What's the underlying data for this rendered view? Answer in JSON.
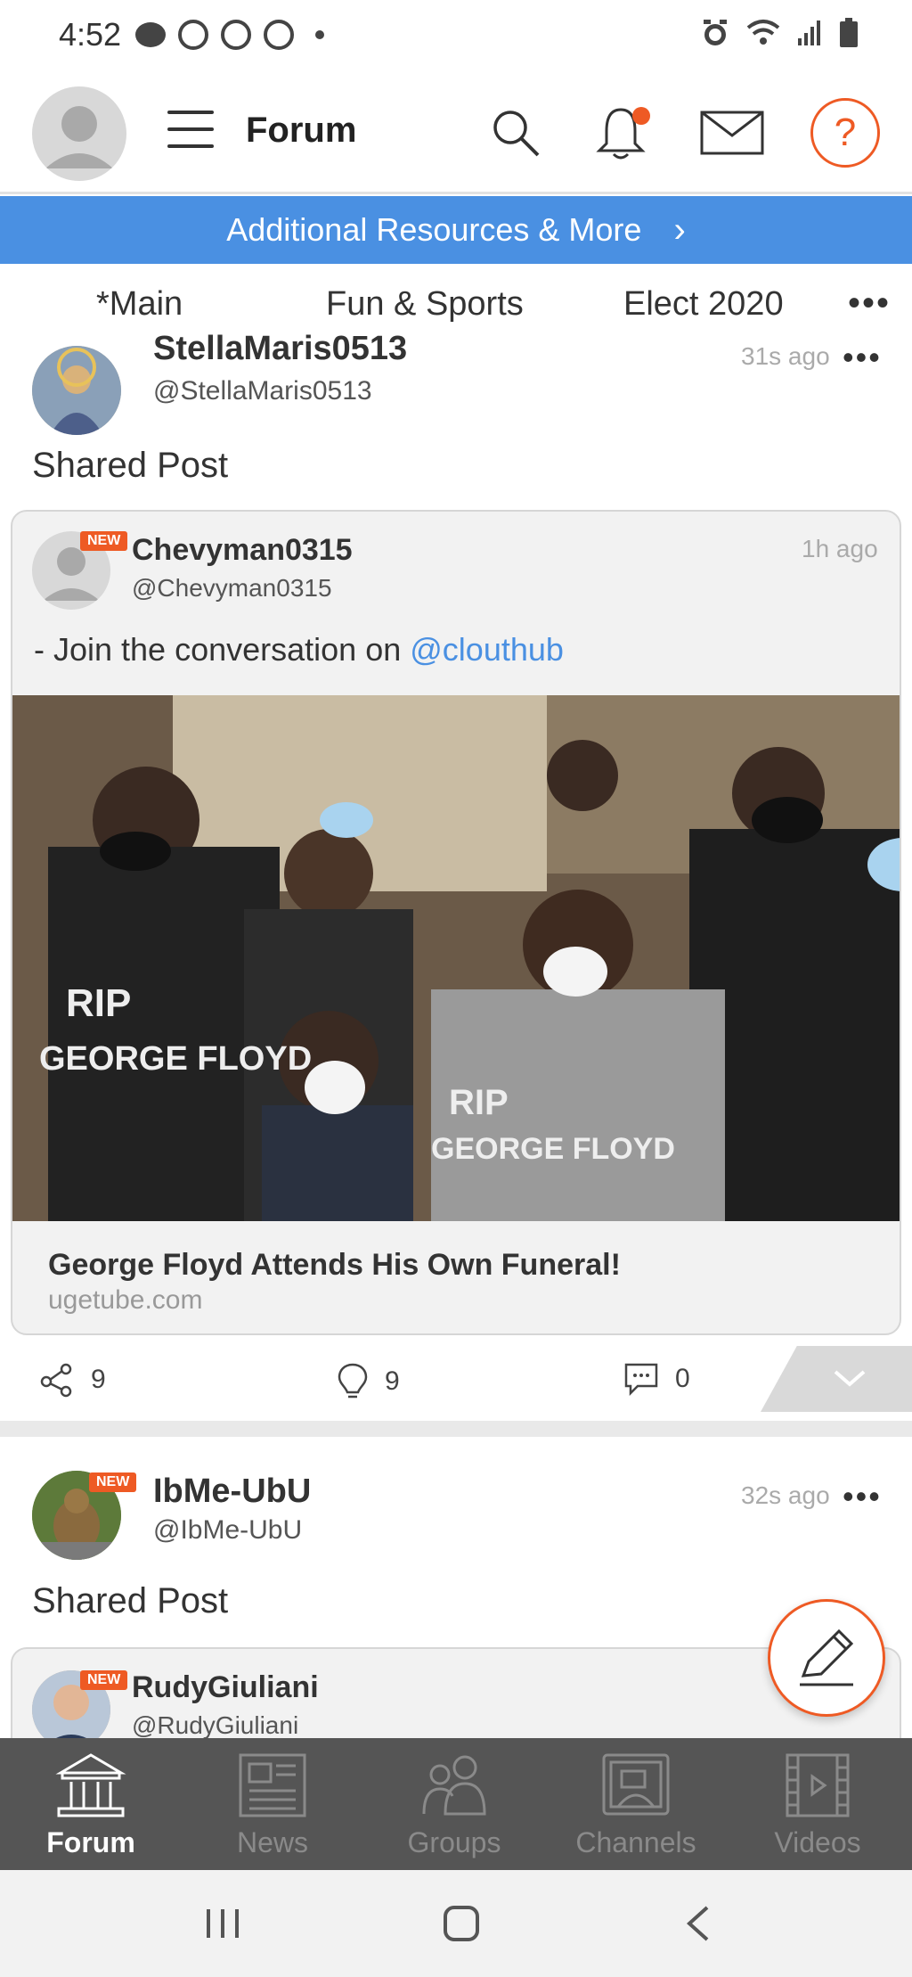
{
  "status_bar": {
    "time": "4:52"
  },
  "header": {
    "title": "Forum"
  },
  "banner": {
    "text": "Additional Resources & More",
    "chevron": "›"
  },
  "tabs": [
    {
      "label": "*Main",
      "active": true
    },
    {
      "label": "Fun & Sports",
      "active": false
    },
    {
      "label": "Elect 2020",
      "active": false
    }
  ],
  "tabs_more": "•••",
  "post1": {
    "name": "StellaMaris0513",
    "handle": "@StellaMaris0513",
    "time": "31s ago",
    "menu": "•••",
    "label": "Shared Post",
    "shared": {
      "badge": "NEW",
      "name": "Chevyman0315",
      "handle": "@Chevyman0315",
      "time": "1h ago",
      "text_prefix": "- Join the conversation on ",
      "mention": "@clouthub",
      "link_title": "George Floyd Attends His Own Funeral!",
      "link_domain": "ugetube.com"
    },
    "actions": {
      "shares": "9",
      "ideas": "9",
      "comments": "0"
    }
  },
  "post2": {
    "badge": "NEW",
    "name": "IbMe-UbU",
    "handle": "@IbMe-UbU",
    "time": "32s ago",
    "menu": "•••",
    "label": "Shared Post",
    "shared": {
      "badge": "NEW",
      "name": "RudyGiuliani",
      "handle": "@RudyGiuliani"
    }
  },
  "bottom_nav": [
    {
      "label": "Forum",
      "icon": "forum-icon",
      "active": true
    },
    {
      "label": "News",
      "icon": "news-icon",
      "active": false
    },
    {
      "label": "Groups",
      "icon": "groups-icon",
      "active": false
    },
    {
      "label": "Channels",
      "icon": "channels-icon",
      "active": false
    },
    {
      "label": "Videos",
      "icon": "videos-icon",
      "active": false
    }
  ],
  "colors": {
    "accent": "#ee5a24",
    "banner": "#4a90e2",
    "nav_bg": "#555555"
  }
}
